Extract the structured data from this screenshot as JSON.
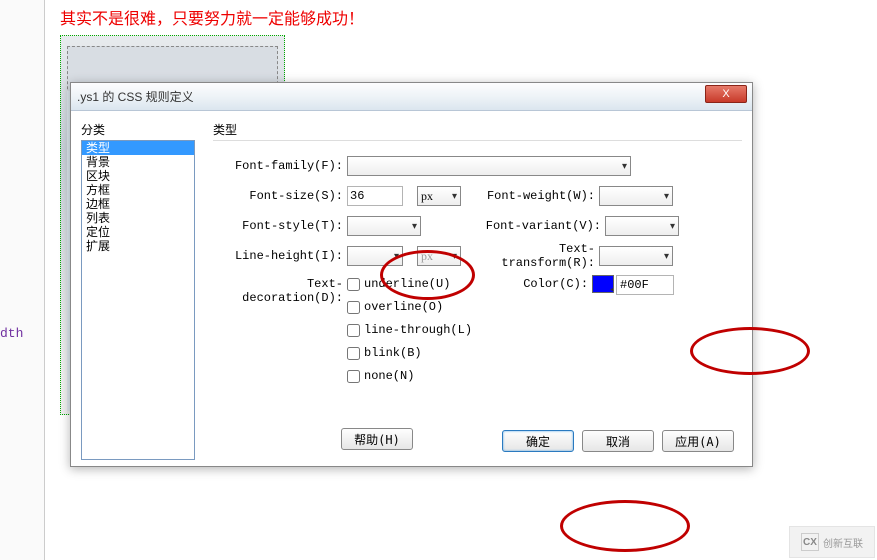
{
  "page": {
    "banner_text": "其实不是很难，只要努力就一定能够成功！",
    "side_label": "dth"
  },
  "dialog": {
    "title": ".ys1 的 CSS 规则定义",
    "close_icon": "X",
    "category_label": "分类",
    "categories": [
      "类型",
      "背景",
      "区块",
      "方框",
      "边框",
      "列表",
      "定位",
      "扩展"
    ],
    "selected_category_index": 0,
    "form_title": "类型",
    "labels": {
      "font_family": "Font-family(F):",
      "font_size": "Font-size(S):",
      "font_weight": "Font-weight(W):",
      "font_style": "Font-style(T):",
      "font_variant": "Font-variant(V):",
      "line_height": "Line-height(I):",
      "text_transform": "Text-transform(R):",
      "text_decoration": "Text-decoration(D):",
      "color": "Color(C):"
    },
    "values": {
      "font_size": "36",
      "font_size_unit": "px",
      "line_height_unit": "px",
      "color_hex": "#00F"
    },
    "decorations": {
      "underline": "underline(U)",
      "overline": "overline(O)",
      "line_through": "line-through(L)",
      "blink": "blink(B)",
      "none": "none(N)"
    },
    "buttons": {
      "help": "帮助(H)",
      "ok": "确定",
      "cancel": "取消",
      "apply": "应用(A)"
    }
  },
  "watermark": {
    "logo_text": "CX",
    "text": "创新互联"
  }
}
